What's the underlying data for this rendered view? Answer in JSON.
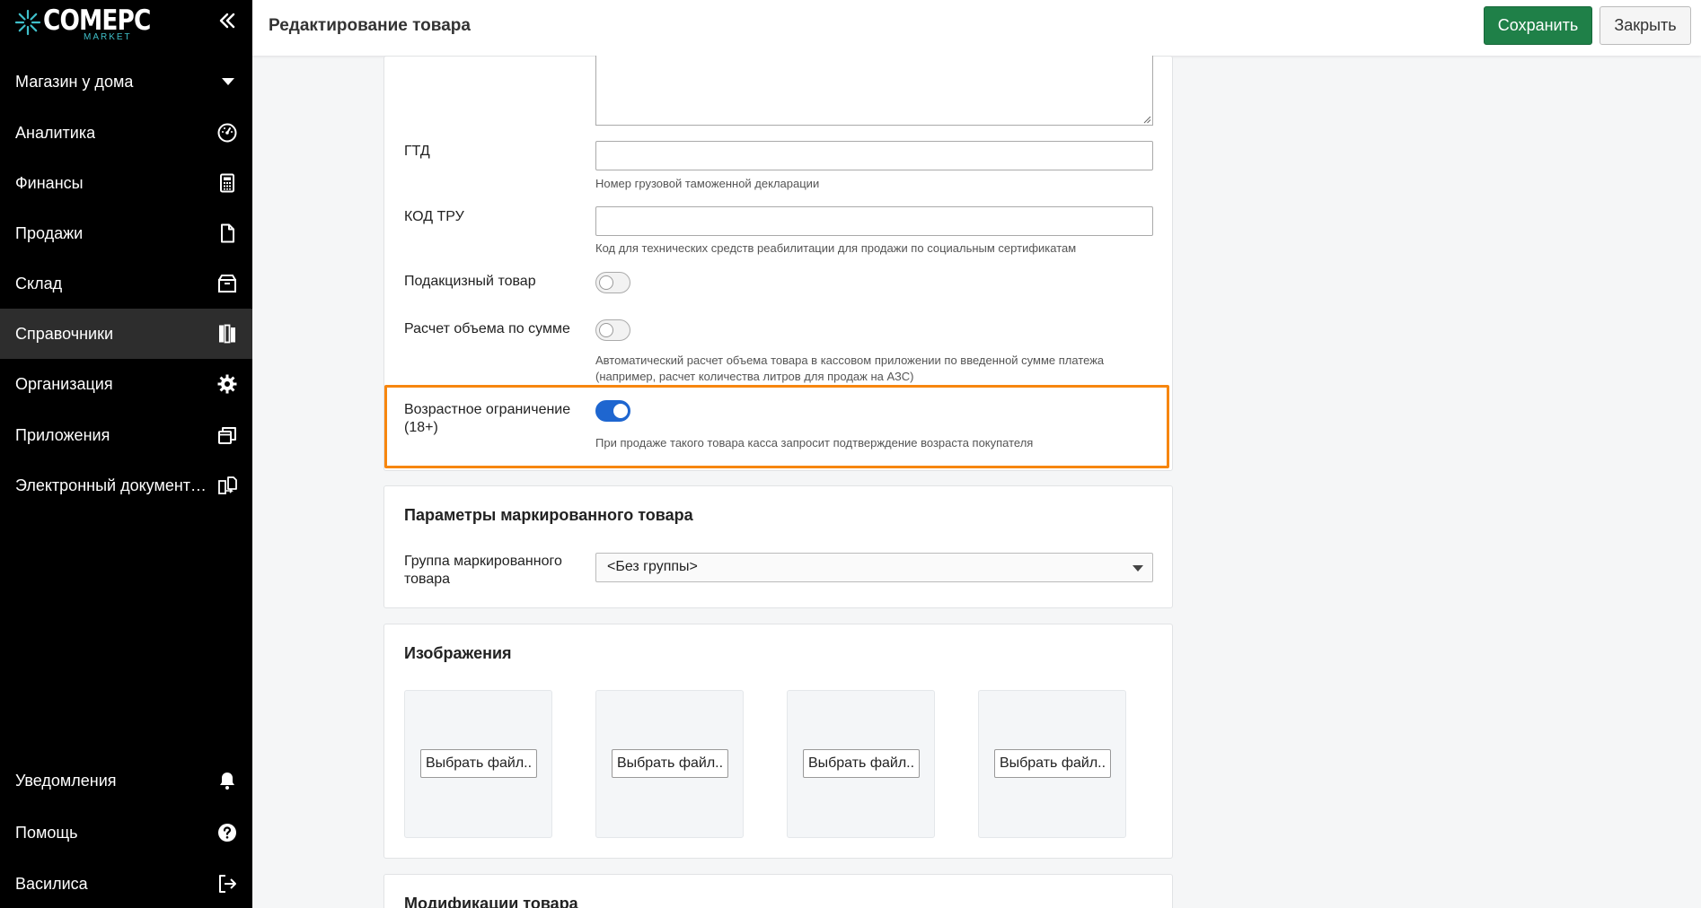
{
  "app": {
    "logo_text": "COMEPC",
    "logo_sub": "MARKET",
    "store_name": "Магазин у дома"
  },
  "sidebar": {
    "items": [
      {
        "label": "Аналитика",
        "icon": "gauge-icon"
      },
      {
        "label": "Финансы",
        "icon": "calculator-icon"
      },
      {
        "label": "Продажи",
        "icon": "document-icon"
      },
      {
        "label": "Склад",
        "icon": "box-icon"
      },
      {
        "label": "Справочники",
        "icon": "books-icon",
        "active": true
      },
      {
        "label": "Организация",
        "icon": "gear-icon"
      },
      {
        "label": "Приложения",
        "icon": "windows-icon"
      },
      {
        "label": "Электронный документооборот",
        "icon": "doc-exchange-icon"
      }
    ],
    "bottom": [
      {
        "label": "Уведомления",
        "icon": "bell-icon"
      },
      {
        "label": "Помощь",
        "icon": "help-icon"
      },
      {
        "label": "Василиса",
        "icon": "logout-icon"
      }
    ]
  },
  "header": {
    "title": "Редактирование товара",
    "save_label": "Сохранить",
    "close_label": "Закрыть"
  },
  "form": {
    "gtd": {
      "label": "ГТД",
      "value": "",
      "hint": "Номер грузовой таможенной декларации"
    },
    "tru": {
      "label": "КОД ТРУ",
      "value": "",
      "hint": "Код для технических средств реабилитации для продажи по социальным сертификатам"
    },
    "excise": {
      "label": "Подакцизный товар",
      "on": false
    },
    "volume_by_sum": {
      "label": "Расчет объема по сумме",
      "on": false,
      "hint_line1": "Автоматический расчет объема товара в кассовом приложении по введенной сумме платежа",
      "hint_line2": "(например, расчет количества литров для продаж на АЗС)"
    },
    "age_limit": {
      "label_line1": "Возрастное ограничение",
      "label_line2": "(18+)",
      "on": true,
      "hint": "При продаже такого товара касса запросит подтверждение возраста покупателя"
    }
  },
  "marked": {
    "title": "Параметры маркированного товара",
    "group_label_line1": "Группа маркированного",
    "group_label_line2": "товара",
    "group_value": "<Без группы>"
  },
  "images": {
    "title": "Изображения",
    "slots": [
      {
        "button": "Выбрать файл.."
      },
      {
        "button": "Выбрать файл.."
      },
      {
        "button": "Выбрать файл.."
      },
      {
        "button": "Выбрать файл.."
      }
    ]
  },
  "modifications": {
    "title": "Модификации товара"
  },
  "colors": {
    "sidebar_bg": "#000000",
    "active_item": "#2d2d2d",
    "save_green": "#1f8048",
    "toggle_blue": "#1e66d0",
    "highlight_orange": "#f7860f",
    "logo_accent": "#3fbfc9"
  }
}
